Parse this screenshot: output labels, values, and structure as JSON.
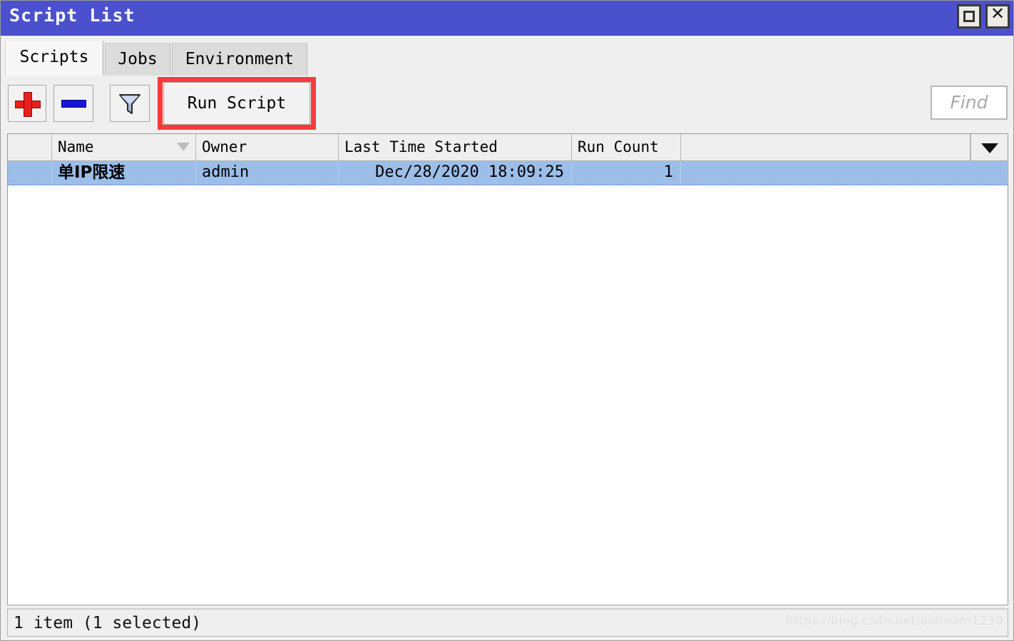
{
  "window": {
    "title": "Script List",
    "restore_label": "restore",
    "close_label": "✕"
  },
  "tabs": [
    {
      "label": "Scripts",
      "active": true
    },
    {
      "label": "Jobs",
      "active": false
    },
    {
      "label": "Environment",
      "active": false
    }
  ],
  "toolbar": {
    "add_label": "+",
    "remove_label": "−",
    "filter_label": "filter",
    "run_script_label": "Run Script",
    "highlight_color": "#f93b3b",
    "find": {
      "value": "",
      "placeholder": "Find"
    }
  },
  "table": {
    "columns": [
      {
        "key": "flag",
        "label": ""
      },
      {
        "key": "name",
        "label": "Name",
        "sorted": true
      },
      {
        "key": "owner",
        "label": "Owner"
      },
      {
        "key": "last_time_started",
        "label": "Last Time Started"
      },
      {
        "key": "run_count",
        "label": "Run Count"
      },
      {
        "key": "spare",
        "label": ""
      }
    ],
    "rows": [
      {
        "flag": "",
        "name": "单IP限速",
        "owner": "admin",
        "last_time_started": "Dec/28/2020 18:09:25",
        "run_count": "1",
        "spare": "",
        "selected": true
      }
    ],
    "menu_icon": "chevron-down-icon"
  },
  "statusbar": {
    "text": "1 item (1 selected)",
    "watermark": "https://blog.csdn.net/aidream1239"
  },
  "colors": {
    "titlebar": "#4b51cc",
    "selection": "#9cbee9",
    "chrome": "#efefef",
    "accent_red": "#e8201d",
    "accent_blue": "#1616d8"
  }
}
